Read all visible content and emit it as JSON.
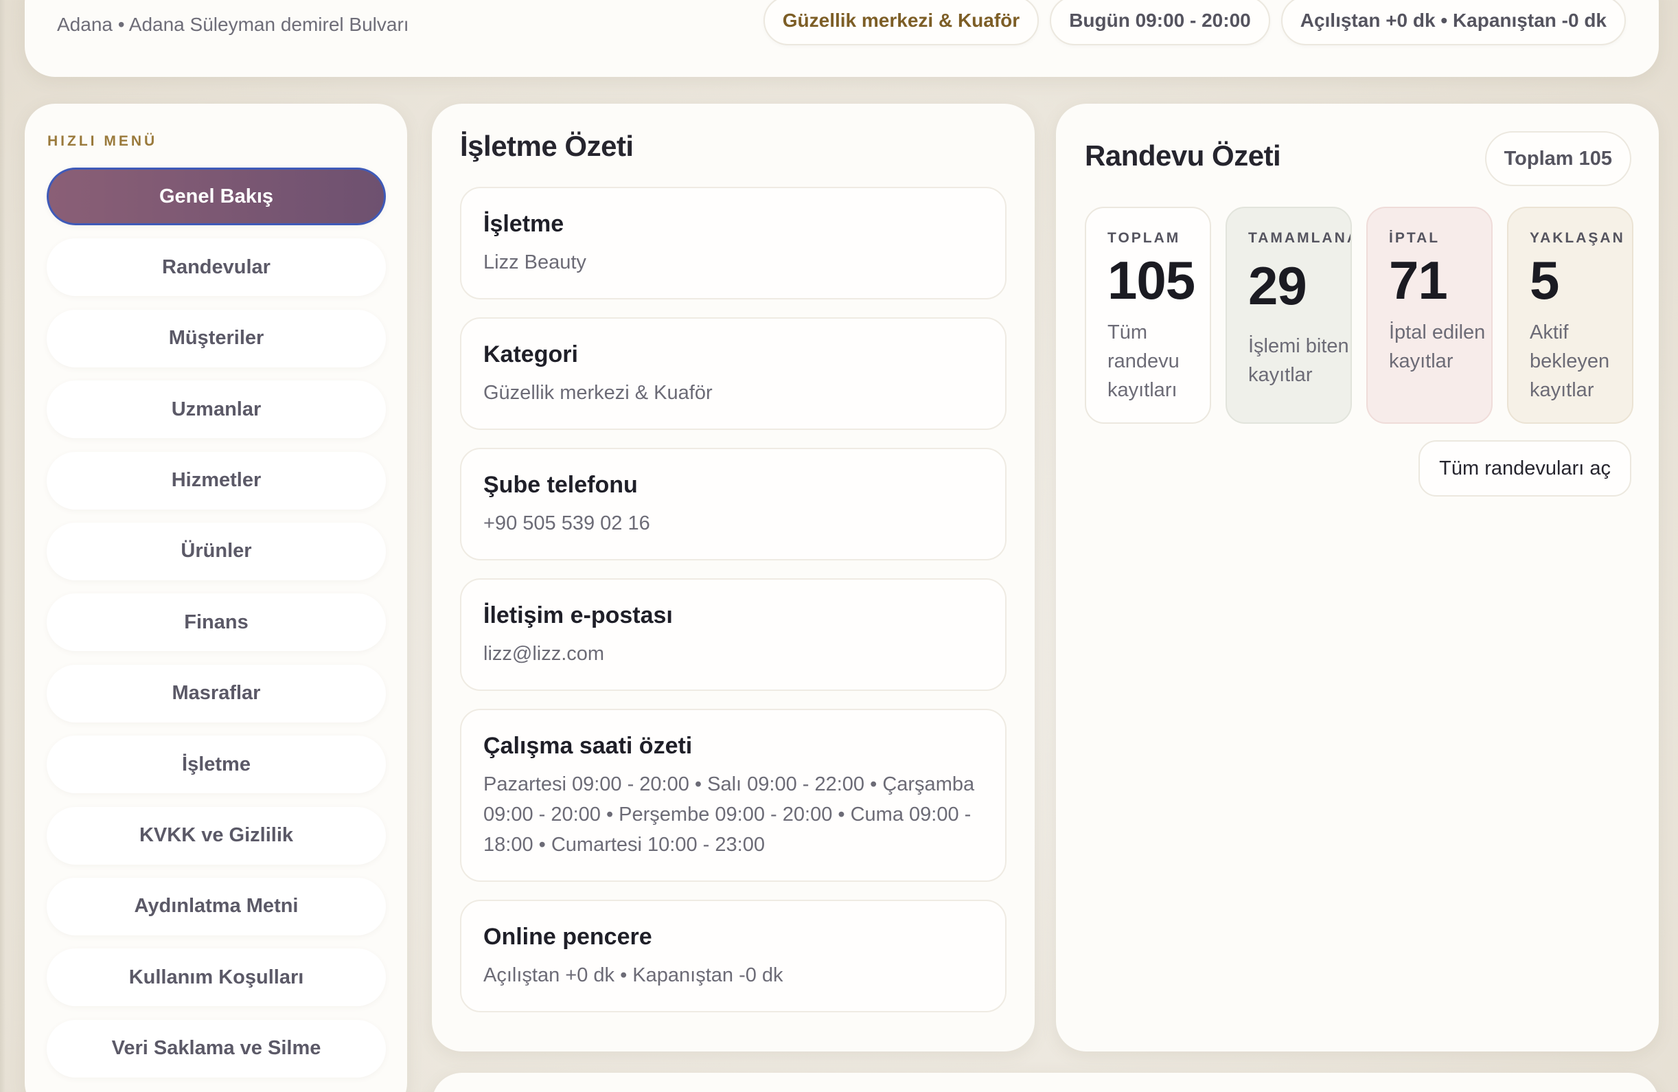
{
  "header": {
    "location": "Adana • Adana Süleyman demirel Bulvarı",
    "chips": [
      {
        "label": "Güzellik merkezi & Kuaför"
      },
      {
        "label": "Bugün 09:00 - 20:00"
      },
      {
        "label": "Açılıştan +0 dk • Kapanıştan -0 dk"
      }
    ]
  },
  "sidebar": {
    "heading": "HIZLI MENÜ",
    "items": [
      {
        "label": "Genel Bakış"
      },
      {
        "label": "Randevular"
      },
      {
        "label": "Müşteriler"
      },
      {
        "label": "Uzmanlar"
      },
      {
        "label": "Hizmetler"
      },
      {
        "label": "Ürünler"
      },
      {
        "label": "Finans"
      },
      {
        "label": "Masraflar"
      },
      {
        "label": "İşletme"
      },
      {
        "label": "KVKK ve Gizlilik"
      },
      {
        "label": "Aydınlatma Metni"
      },
      {
        "label": "Kullanım Koşulları"
      },
      {
        "label": "Veri Saklama ve Silme"
      }
    ]
  },
  "business": {
    "title": "İşletme Özeti",
    "fields": [
      {
        "label": "İşletme",
        "value": "Lizz Beauty"
      },
      {
        "label": "Kategori",
        "value": "Güzellik merkezi & Kuaför"
      },
      {
        "label": "Şube telefonu",
        "value": "+90 505 539 02 16"
      },
      {
        "label": "İletişim e-postası",
        "value": "lizz@lizz.com"
      },
      {
        "label": "Çalışma saati özeti",
        "value": "Pazartesi 09:00 - 20:00 • Salı 09:00 - 22:00 • Çarşamba 09:00 - 20:00 • Perşembe 09:00 - 20:00 • Cuma 09:00 - 18:00 • Cumartesi 10:00 - 23:00"
      },
      {
        "label": "Online pencere",
        "value": "Açılıştan +0 dk • Kapanıştan -0 dk"
      }
    ]
  },
  "appointments": {
    "title": "Randevu Özeti",
    "total_chip": "Toplam 105",
    "stats": [
      {
        "label": "TOPLAM",
        "value": "105",
        "desc": "Tüm randevu kayıtları"
      },
      {
        "label": "TAMAMLANAN",
        "value": "29",
        "desc": "İşlemi biten kayıtlar"
      },
      {
        "label": "İPTAL",
        "value": "71",
        "desc": "İptal edilen kayıtlar"
      },
      {
        "label": "YAKLAŞAN",
        "value": "5",
        "desc": "Aktif bekleyen kayıtlar"
      }
    ],
    "link_label": "Tüm randevuları aç"
  },
  "colors": {
    "accent_active": "#7d5873",
    "active_border": "#3f5ab8",
    "gold": "#9a7a3c"
  }
}
